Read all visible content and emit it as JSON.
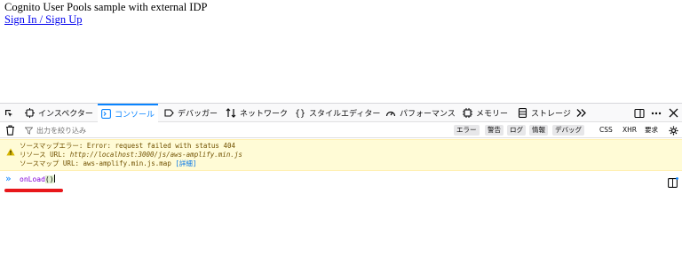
{
  "page": {
    "title": "Cognito User Pools sample with external IDP",
    "link": "Sign In / Sign Up"
  },
  "devtools": {
    "tabs": [
      {
        "label": "インスペクター",
        "icon": "inspector-icon"
      },
      {
        "label": "コンソール",
        "icon": "console-icon",
        "active": true
      },
      {
        "label": "デバッガー",
        "icon": "debugger-icon"
      },
      {
        "label": "ネットワーク",
        "icon": "network-icon"
      },
      {
        "label": "スタイルエディター",
        "icon": "style-editor-icon"
      },
      {
        "label": "パフォーマンス",
        "icon": "performance-icon"
      },
      {
        "label": "メモリー",
        "icon": "memory-icon"
      },
      {
        "label": "ストレージ",
        "icon": "storage-icon"
      }
    ],
    "filter": {
      "placeholder": "出力を絞り込み",
      "levels": [
        "エラー",
        "警告",
        "ログ",
        "情報",
        "デバッグ"
      ],
      "extras": [
        "CSS",
        "XHR",
        "要求"
      ]
    },
    "warning": {
      "line1": "ソースマップエラー: Error: request failed with status 404",
      "line2_prefix": "リソース URL: ",
      "line2_url": "http://localhost:3000/js/aws-amplify.min.js",
      "line3_prefix": "ソースマップ URL: aws-amplify.min.js.map ",
      "line3_link": "[詳細]"
    },
    "input": {
      "prompt": "»",
      "func": "onLoad",
      "parens": "()"
    }
  },
  "colors": {
    "accent": "#0a84ff",
    "warning_bg": "#fffbd6",
    "warning_text": "#715100",
    "input_text": "#8000d7",
    "underline": "#e8171b"
  }
}
